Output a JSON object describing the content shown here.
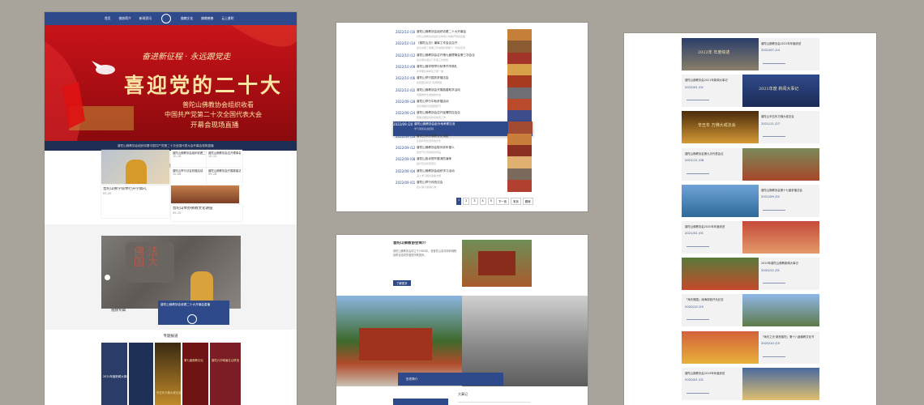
{
  "panel1": {
    "nav": [
      "首页",
      "佛协简介",
      "新闻资讯",
      "",
      "佛教文化",
      "佛教慈善",
      "云上普陀"
    ],
    "banner": {
      "slogan": "奋进新征程 · 永远跟党走",
      "headline": "喜迎党的二十大",
      "line1": "普陀山佛教协会组织收看",
      "line2": "中国共产党第二十次全国代表大会",
      "line3": "开幕会现场直播"
    },
    "ticker": "普陀山佛教协会组织收看中国共产党第二十次全国代表大会开幕会现场直播",
    "news_title": "新闻资讯",
    "news_items": [
      {
        "title": "普陀山佛教协会组织收看二十大开幕会",
        "date": "10-16"
      },
      {
        "title": "普陀山佛教协会召开理事会议",
        "date": "10-12"
      },
      {
        "title": "普陀山举行法会祈福活动",
        "date": "10-08"
      },
      {
        "title": "普陀山佛教协会开展慈善活动",
        "date": "09-28"
      },
      {
        "title": "普陀山佛学院举行开学典礼",
        "date": "09-20"
      },
      {
        "title": "普陀山举办佛教文化讲座",
        "date": "09-15"
      }
    ],
    "video_caption": "普陀山佛教协会收看二十大开幕会直播",
    "video_label": "视频专辑",
    "special_title": "专题报道",
    "special_items": [
      "2021年度新闻大事记",
      "辛丑年万佛大戒法会",
      "第七届佛教论坛",
      "普陀九华峨眉名山联谊"
    ]
  },
  "panel2": {
    "rows": [
      {
        "date": "2022/10 /16",
        "title": "普陀山佛教协会组织收看二十大开幕会",
        "sub": "普陀山佛教协会组织全体僧众收看开幕会直播"
      },
      {
        "date": "2022/10 /14",
        "title": "《普陀山志》编纂工作会议召开",
        "sub": "会议总结了编纂工作进展并部署下一阶段任务"
      },
      {
        "date": "2022/10 /12",
        "title": "普陀山佛教协会召开第九届理事会第三次会议",
        "sub": "会议审议通过了年度工作报告"
      },
      {
        "date": "2022/10 /09",
        "title": "普陀山佛学院举行秋季开学典礼",
        "sub": "新学期全体师生齐聚一堂"
      },
      {
        "date": "2022/10 /06",
        "title": "普陀山举行国庆祈福法会",
        "sub": "祈愿国泰民安 风调雨顺"
      },
      {
        "date": "2022/10 /02",
        "title": "普陀山佛教协会开展慈善助学活动",
        "sub": "向困难学生发放助学金"
      },
      {
        "date": "2022/09 /28",
        "title": "普陀山举行中秋祈福活动",
        "sub": "海天佛国共庆团圆佳节"
      },
      {
        "date": "2022/09 /24",
        "title": "普陀山佛教协会召开疫情防控会议",
        "sub": "部署近期疫情防控各项工作"
      },
      {
        "date": "2022/09 /20",
        "title": "普陀山佛教协会赴外地考察交流",
        "sub": "学习借鉴先进经验"
      },
      {
        "date": "2022/09 /16",
        "title": "普陀山举办佛教文化讲座",
        "sub": "弘扬中华优秀传统文化"
      },
      {
        "date": "2022/09 /12",
        "title": "普陀山佛教协会慰问老年僧人",
        "sub": "送去节日问候和慰问品"
      },
      {
        "date": "2022/09 /08",
        "title": "普陀山各寺院开展消防演练",
        "sub": "提升安全防范意识"
      },
      {
        "date": "2022/09 /04",
        "title": "普陀山佛教协会组织学习活动",
        "sub": "深入学习相关政策法规"
      },
      {
        "date": "2022/09 /01",
        "title": "普陀山举行传统法会",
        "sub": "四众弟子虔诚礼佛"
      }
    ],
    "pagination": [
      "1",
      "2",
      "3",
      "4",
      "5",
      "下一页",
      "末页",
      "跳转"
    ]
  },
  "panel3": {
    "title": "普陀山佛教协会简介",
    "text": "普陀山佛教协会成立于1985年，是普陀山各寺院和佛教徒联合组成的爱国宗教团体。",
    "button": "了解更多",
    "caption": "历史简介",
    "bottom_title": "大事记"
  },
  "panel4": {
    "rows": [
      {
        "title": "普陀山佛教协会2022年年度综述",
        "date": "2022/07 /14",
        "img_text": "2022年 年度综述"
      },
      {
        "title": "普陀山佛教协会2021年新闻大事记",
        "date": "2022/01 /01",
        "img_text": "2021年度 新闻大事记"
      },
      {
        "title": "普陀山辛丑年万佛大戒法会",
        "date": "2021/11 /27",
        "img_text": "辛丑年 万佛大戒法会"
      },
      {
        "title": "普陀山佛教协会第九次代表会议",
        "date": "2021/11 /08",
        "img_text": ""
      },
      {
        "title": "普陀山佛教协会第十七届祈福法会",
        "date": "2021/09 /22",
        "img_text": ""
      },
      {
        "title": "普陀山佛教协会2020年年度综述",
        "date": "2021/01 /01",
        "img_text": ""
      },
      {
        "title": "2020年普陀山佛教新闻大事记",
        "date": "2020/12 /31",
        "img_text": ""
      },
      {
        "title": "「海天佛国」南海观音开光纪念",
        "date": "2020/10 /25",
        "img_text": ""
      },
      {
        "title": "「海天之光·慈悲普陀」第十八届佛教文化节",
        "date": "2020/10 /15",
        "img_text": ""
      },
      {
        "title": "普陀山佛教协会2019年年度综述",
        "date": "2020/01 /01",
        "img_text": ""
      }
    ]
  }
}
